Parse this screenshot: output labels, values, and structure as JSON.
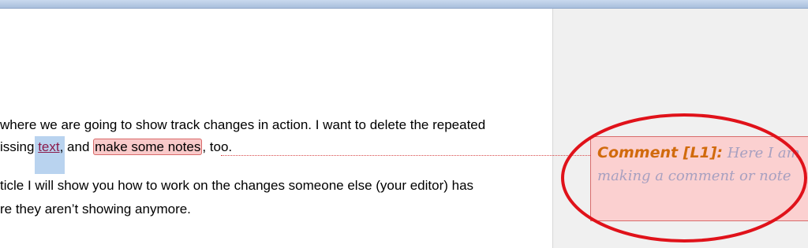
{
  "document": {
    "line1": "where we are going to show track changes in action. I want to delete the repeated",
    "line2_prefix": "issing ",
    "line2_inserted": "text",
    "line2_mid": ", and ",
    "line2_comment_range": "make some notes",
    "line2_suffix": ", too.",
    "line3": "ticle I will show you how to work on the changes someone else (your editor) has",
    "line4": "re they aren’t showing anymore."
  },
  "comment": {
    "author_label": "Comment [L1]:",
    "body": " Here I am making a comment or note"
  },
  "colors": {
    "insertion": "#8b1a4a",
    "comment_fill": "#fbd0d0",
    "comment_border": "#d86b6b",
    "author_text": "#d16a0c",
    "annotation_circle": "#e0121a"
  }
}
